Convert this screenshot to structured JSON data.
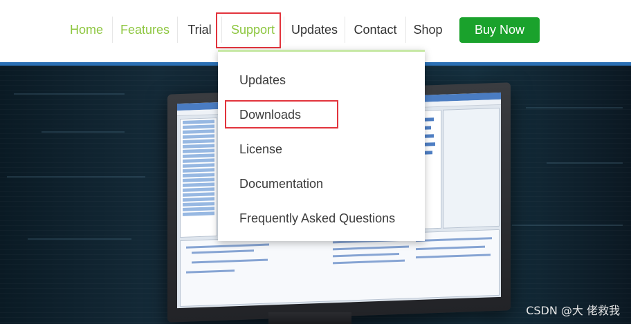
{
  "nav": {
    "items": [
      {
        "label": "Home"
      },
      {
        "label": "Features"
      },
      {
        "label": "Trial"
      },
      {
        "label": "Support"
      },
      {
        "label": "Updates"
      },
      {
        "label": "Contact"
      },
      {
        "label": "Shop"
      }
    ],
    "buy_label": "Buy Now"
  },
  "dropdown": {
    "items": [
      {
        "label": "Updates"
      },
      {
        "label": "Downloads"
      },
      {
        "label": "License"
      },
      {
        "label": "Documentation"
      },
      {
        "label": "Frequently Asked Questions"
      }
    ]
  },
  "watermark": "CSDN @大 佬救我",
  "colors": {
    "active_nav": "#8dc63f",
    "buy_button": "#1aa22c",
    "highlight_box": "#e2333c",
    "accent_strip": "#2a6fb4"
  }
}
